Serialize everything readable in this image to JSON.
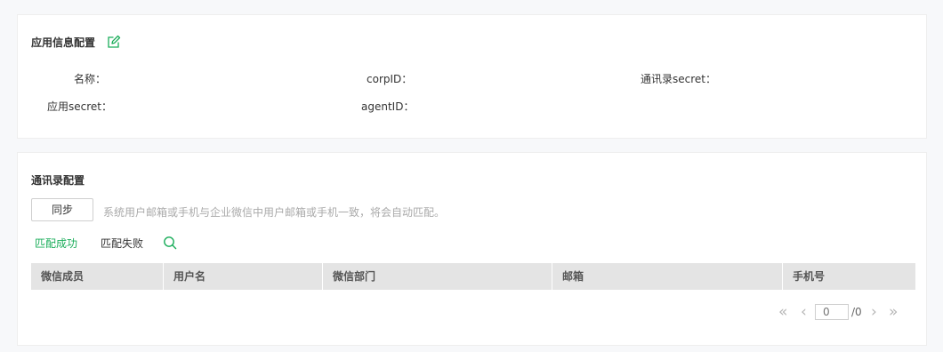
{
  "app_config": {
    "title": "应用信息配置",
    "fields": {
      "name_label": "名称：",
      "corpid_label": "corpID：",
      "contacts_secret_label": "通讯录secret：",
      "app_secret_label": "应用secret：",
      "agentid_label": "agentID："
    }
  },
  "contacts_config": {
    "title": "通讯录配置",
    "sync_button": "同步",
    "hint": "系统用户邮箱或手机与企业微信中用户邮箱或手机一致，将会自动匹配。",
    "filters": {
      "success": "匹配成功",
      "failed": "匹配失败"
    },
    "table": {
      "columns": [
        "微信成员",
        "用户名",
        "微信部门",
        "邮箱",
        "手机号"
      ],
      "rows": []
    },
    "pager": {
      "first": "«",
      "prev": "‹",
      "next": "›",
      "last": "»",
      "current_page_placeholder": "0",
      "total": "/0"
    }
  },
  "colors": {
    "accent_green": "#1aad5a",
    "header_bg": "#e4e4e4"
  },
  "icons": {
    "edit": "edit-icon",
    "search": "search-icon"
  }
}
